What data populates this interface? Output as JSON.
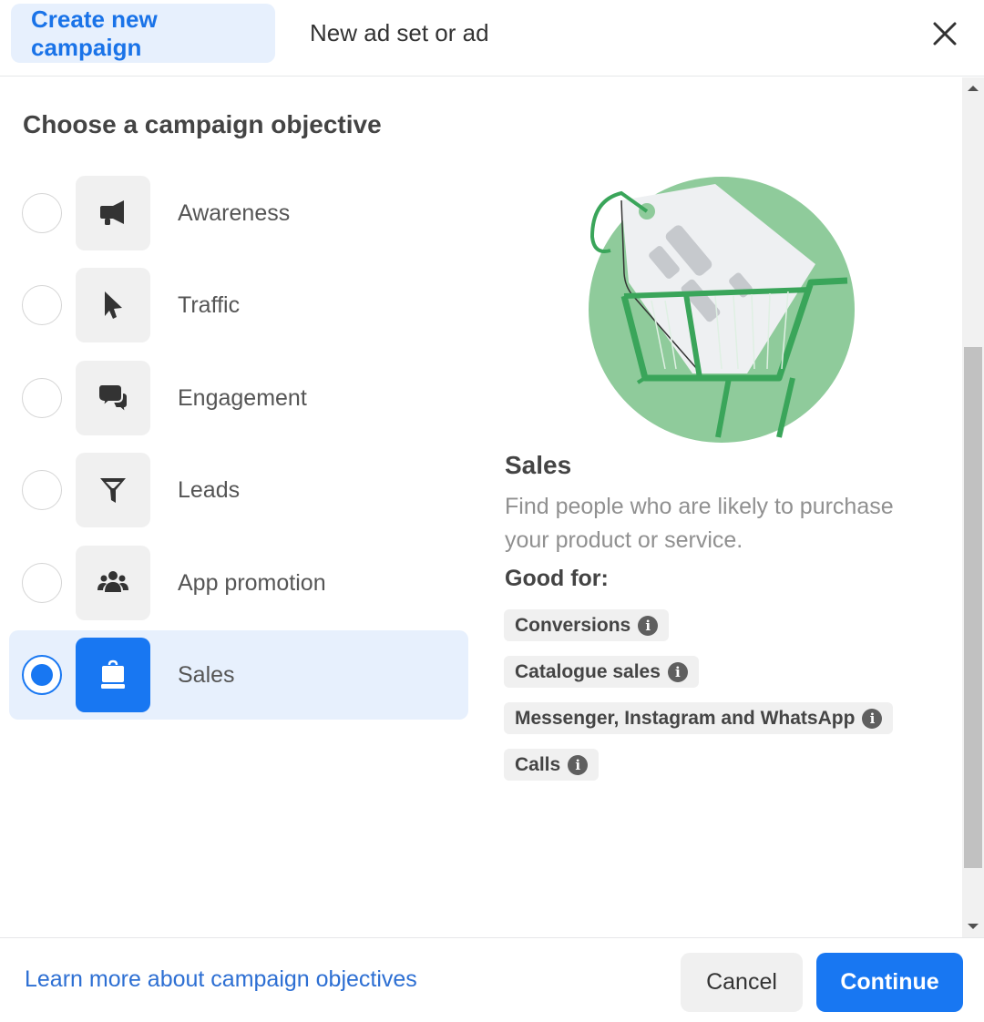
{
  "header": {
    "tabs": [
      {
        "label": "Create new campaign",
        "active": true
      },
      {
        "label": "New ad set or ad",
        "active": false
      }
    ],
    "close_icon": "close-icon"
  },
  "main": {
    "title": "Choose a campaign objective",
    "objectives": [
      {
        "label": "Awareness",
        "icon": "megaphone-icon",
        "selected": false
      },
      {
        "label": "Traffic",
        "icon": "cursor-icon",
        "selected": false
      },
      {
        "label": "Engagement",
        "icon": "chat-bubbles-icon",
        "selected": false
      },
      {
        "label": "Leads",
        "icon": "funnel-icon",
        "selected": false
      },
      {
        "label": "App promotion",
        "icon": "people-icon",
        "selected": false
      },
      {
        "label": "Sales",
        "icon": "shopping-bag-icon",
        "selected": true
      }
    ],
    "detail": {
      "illustration": "shopping-cart-price-tag-illustration",
      "title": "Sales",
      "description": "Find people who are likely to purchase your product or service.",
      "good_for_label": "Good for:",
      "good_for": [
        {
          "label": "Conversions"
        },
        {
          "label": "Catalogue sales"
        },
        {
          "label": "Messenger, Instagram and WhatsApp"
        },
        {
          "label": "Calls"
        }
      ],
      "info_glyph": "i"
    }
  },
  "footer": {
    "learn_more": "Learn more about campaign objectives",
    "cancel_label": "Cancel",
    "continue_label": "Continue"
  },
  "colors": {
    "accent": "#1877f2",
    "active_tab_bg": "#e7f0fd",
    "illustration_green": "#8fcb9b",
    "illustration_dark_green": "#3aa55a"
  }
}
